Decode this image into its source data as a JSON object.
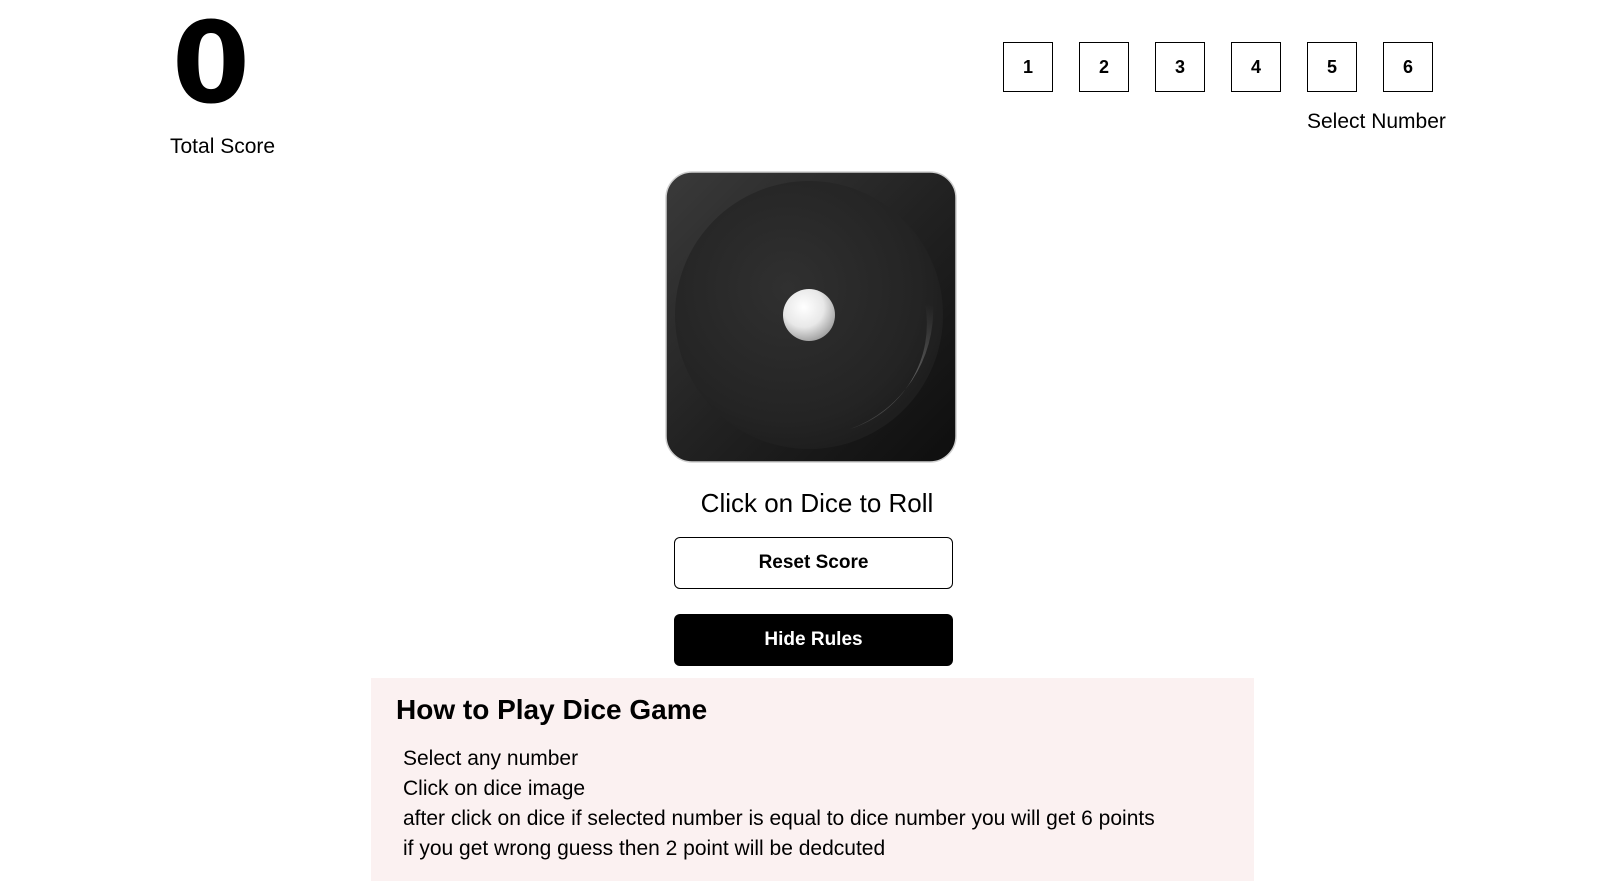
{
  "score": {
    "value": "0",
    "label": "Total Score"
  },
  "number_selector": {
    "options": [
      "1",
      "2",
      "3",
      "4",
      "5",
      "6"
    ],
    "label": "Select Number"
  },
  "dice": {
    "face_value": 1,
    "icon": "dice-one-icon"
  },
  "roll_hint": "Click on Dice to Roll",
  "buttons": {
    "reset_label": "Reset Score",
    "rules_label": "Hide Rules"
  },
  "rules": {
    "title": "How to Play Dice Game",
    "items": [
      "Select any number",
      "Click on dice image",
      "after click on dice if selected number is equal to dice number you will get 6 points",
      "if you get wrong guess then 2 point will be dedcuted"
    ]
  },
  "colors": {
    "rules_background": "#fbf1f1",
    "dice_body": "#1f1f1f",
    "primary_button": "#000000"
  }
}
